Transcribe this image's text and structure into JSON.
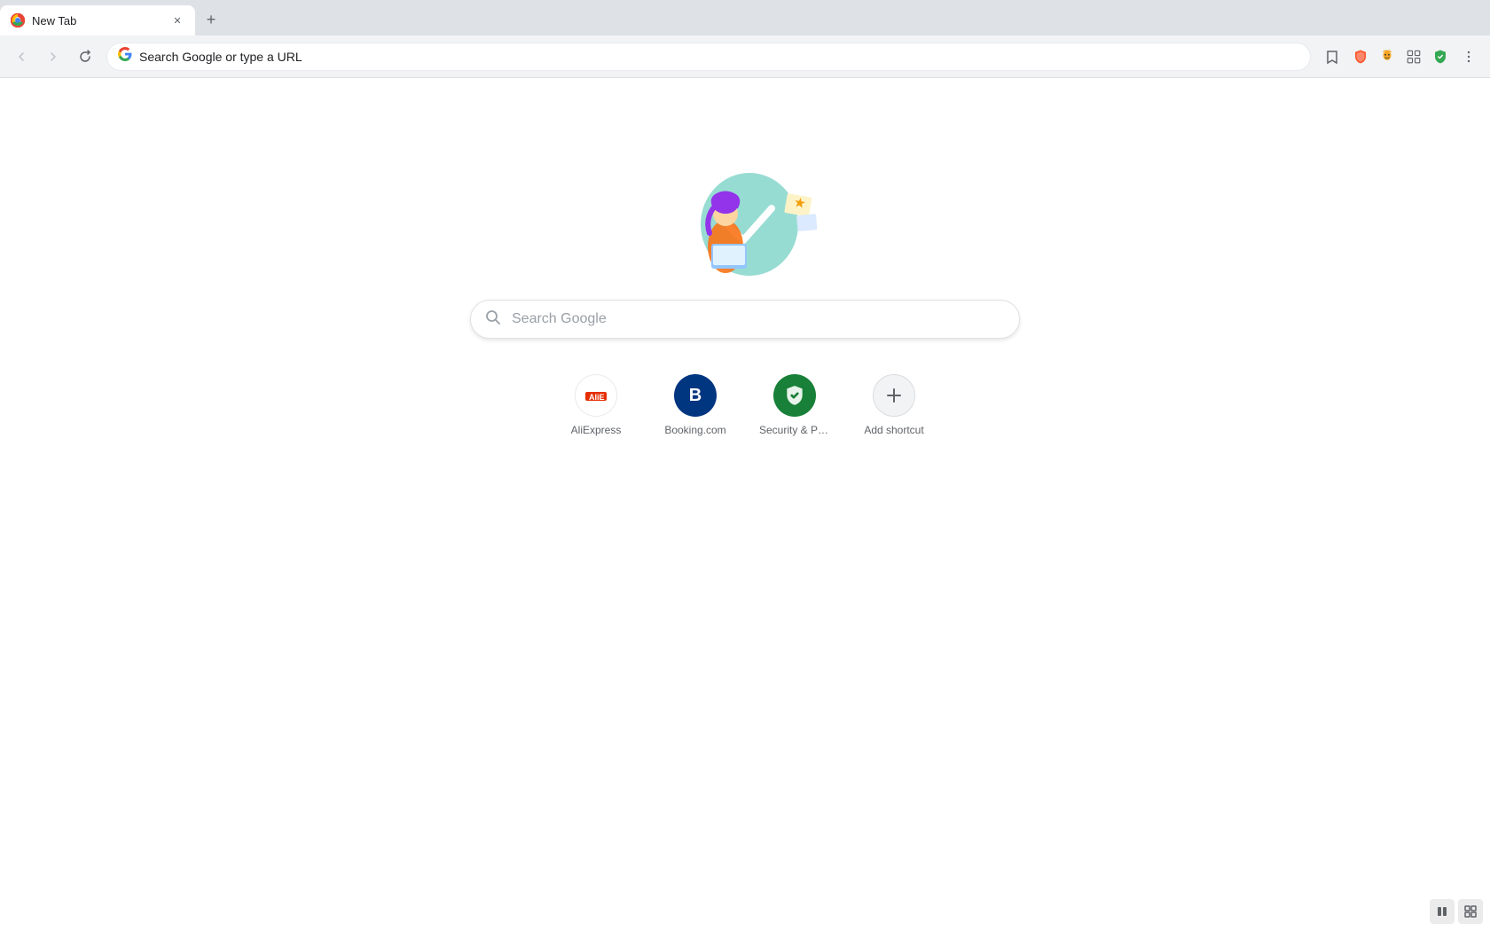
{
  "tab": {
    "title": "New Tab",
    "favicon": "🔵"
  },
  "new_tab_button": "+",
  "nav": {
    "back_label": "←",
    "forward_label": "→",
    "refresh_label": "↻",
    "address_placeholder": "Search Google or type a URL",
    "address_value": "Search Google or type a URL"
  },
  "toolbar": {
    "bookmark_label": "☆",
    "brave_shield_label": "🛡",
    "leo_label": "🦁",
    "extensions_label": "🧩",
    "menu_label": "⋮"
  },
  "search": {
    "placeholder": "Search Google"
  },
  "shortcuts": [
    {
      "id": "aliexpress",
      "label": "AliExpress",
      "icon_type": "aliexpress"
    },
    {
      "id": "booking",
      "label": "Booking.com",
      "icon_type": "booking",
      "icon_letter": "B"
    },
    {
      "id": "security",
      "label": "Security & Priv...",
      "icon_type": "security"
    },
    {
      "id": "add",
      "label": "Add shortcut",
      "icon_type": "add",
      "icon_symbol": "+"
    }
  ],
  "bottom_controls": [
    "⏸",
    "⊞"
  ],
  "colors": {
    "booking_bg": "#003580",
    "security_bg": "#188038",
    "tab_bar_bg": "#dee1e6",
    "nav_bar_bg": "#f1f3f4"
  }
}
